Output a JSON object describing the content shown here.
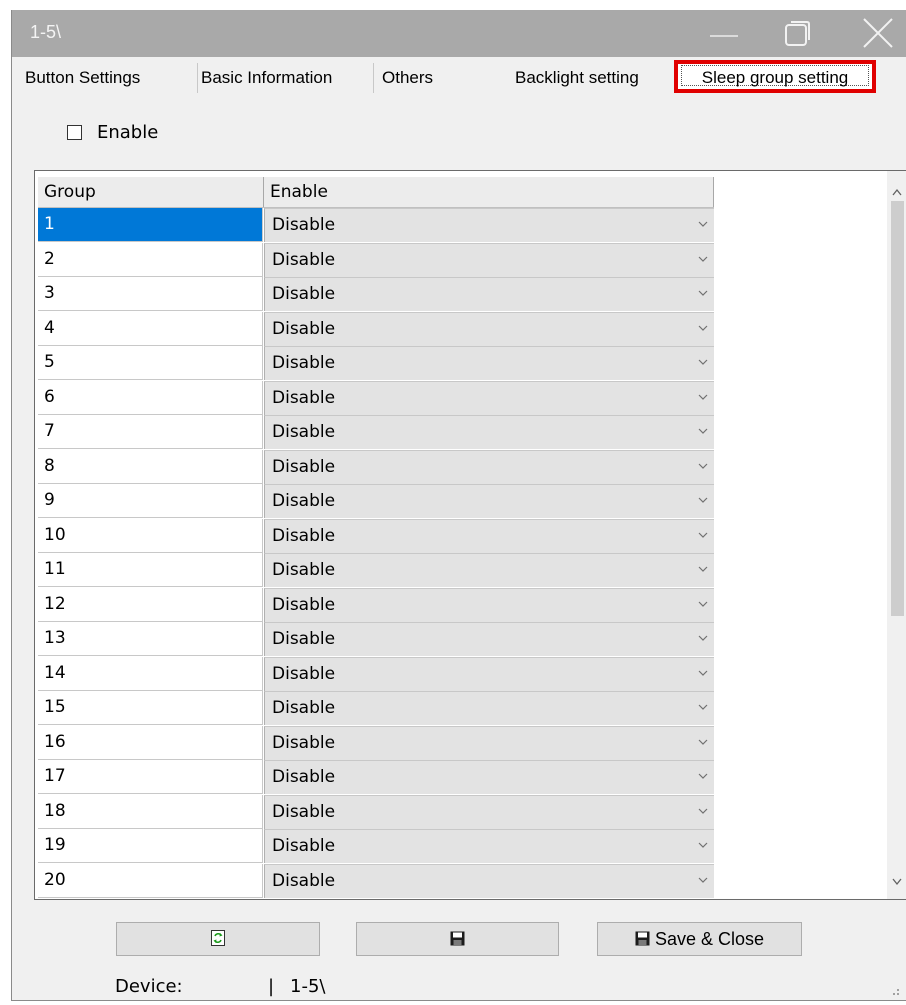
{
  "window": {
    "title": "1-5\\"
  },
  "tabs": [
    {
      "label": "Button Settings"
    },
    {
      "label": "Basic Information"
    },
    {
      "label": "Others"
    },
    {
      "label": "Backlight setting"
    },
    {
      "label": "Sleep group setting",
      "active": true
    }
  ],
  "enable_checkbox": {
    "label": "Enable",
    "checked": false
  },
  "grid": {
    "columns": [
      "Group",
      "Enable"
    ],
    "selected_row": "1",
    "rows": [
      {
        "group": "1",
        "enable": "Disable"
      },
      {
        "group": "2",
        "enable": "Disable"
      },
      {
        "group": "3",
        "enable": "Disable"
      },
      {
        "group": "4",
        "enable": "Disable"
      },
      {
        "group": "5",
        "enable": "Disable"
      },
      {
        "group": "6",
        "enable": "Disable"
      },
      {
        "group": "7",
        "enable": "Disable"
      },
      {
        "group": "8",
        "enable": "Disable"
      },
      {
        "group": "9",
        "enable": "Disable"
      },
      {
        "group": "10",
        "enable": "Disable"
      },
      {
        "group": "11",
        "enable": "Disable"
      },
      {
        "group": "12",
        "enable": "Disable"
      },
      {
        "group": "13",
        "enable": "Disable"
      },
      {
        "group": "14",
        "enable": "Disable"
      },
      {
        "group": "15",
        "enable": "Disable"
      },
      {
        "group": "16",
        "enable": "Disable"
      },
      {
        "group": "17",
        "enable": "Disable"
      },
      {
        "group": "18",
        "enable": "Disable"
      },
      {
        "group": "19",
        "enable": "Disable"
      },
      {
        "group": "20",
        "enable": "Disable"
      }
    ]
  },
  "buttons": {
    "refresh_icon": "refresh-icon",
    "save_icon": "floppy-disk-icon",
    "save_close_label": "Save & Close"
  },
  "status": {
    "device_label": "Device:",
    "separator": "|",
    "device_value": "1-5\\"
  },
  "colors": {
    "titlebar": "#a9a9a9",
    "selection": "#0078d7",
    "highlight_border": "#e00000",
    "dropdown_bg": "#e3e3e3"
  }
}
